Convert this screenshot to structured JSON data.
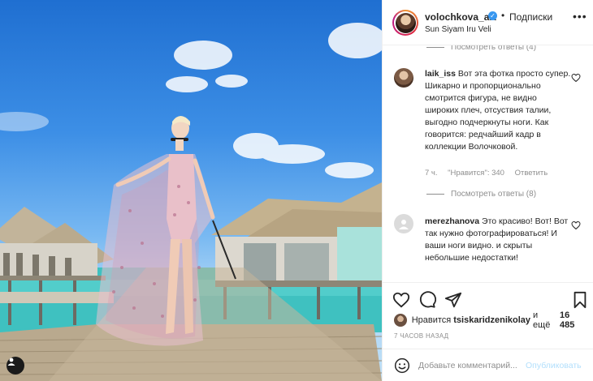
{
  "post": {
    "username": "volochkova_art",
    "follow_label": "Подписки",
    "location": "Sun Siyam Iru Veli"
  },
  "replies": {
    "first": "Посмотреть ответы (4)",
    "second": "Посмотреть ответы (8)"
  },
  "comments": [
    {
      "username": "laik_iss",
      "text": "Вот эта фотка просто супер. Шикарно и пропорционально смотрится фигура, не видно широких плеч, отсуствия талии, выгодно подчеркнуты ноги. Как говорится: редчайший кадр в коллекции Волочковой.",
      "time": "7 ч.",
      "likes": "\"Нравится\": 340",
      "reply": "Ответить"
    },
    {
      "username": "merezhanova",
      "text": "Это красиво! Вот! Вот так нужно фотографироваться! И ваши ноги видно. и скрыты небольшие недостатки!"
    }
  ],
  "likes": {
    "prefix": "Нравится",
    "user": "tsiskaridzenikolay",
    "middle": "и ещё",
    "count": "16 485"
  },
  "timestamp": "7 ЧАСОВ НАЗАД",
  "add_comment": {
    "placeholder": "Добавьте комментарий...",
    "publish": "Опубликовать"
  },
  "colors": {
    "link_blue": "#3897f0",
    "publish_disabled": "#b2dffc",
    "muted": "#8e8e8e",
    "border": "#efefef"
  },
  "icons": {
    "like": "heart-icon",
    "comment": "comment-icon",
    "share": "share-icon",
    "save": "bookmark-icon",
    "emoji": "smiley-icon",
    "more": "more-icon",
    "tag": "user-tag-icon"
  }
}
